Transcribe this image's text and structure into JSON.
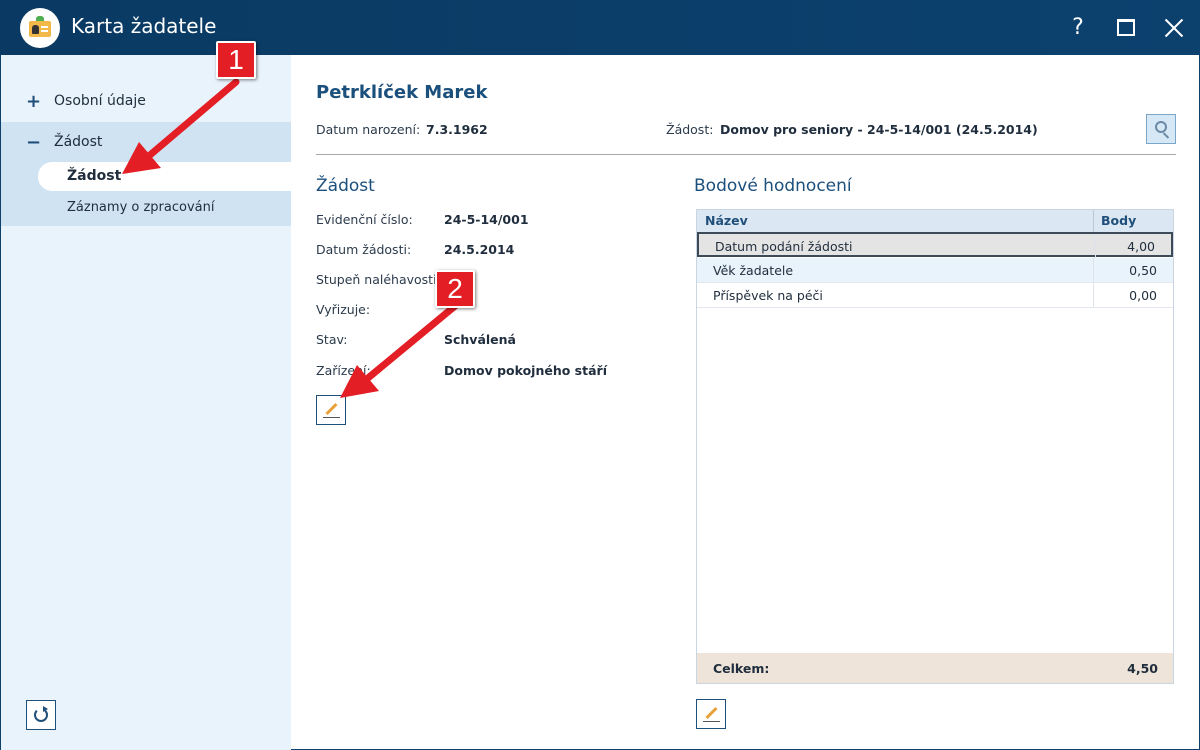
{
  "window": {
    "title": "Karta žadatele",
    "help_label": "?"
  },
  "sidebar": {
    "items": [
      {
        "sign": "+",
        "label": "Osobní údaje"
      },
      {
        "sign": "−",
        "label": "Žádost"
      }
    ],
    "subitems": [
      {
        "label": "Žádost",
        "active": true
      },
      {
        "label": "Záznamy o zpracování"
      }
    ]
  },
  "header": {
    "name": "Petrklíček Marek",
    "birth_label": "Datum narození:",
    "birth_value": "7.3.1962",
    "request_label": "Žádost:",
    "request_value": "Domov pro seniory - 24-5-14/001 (24.5.2014)"
  },
  "request": {
    "title": "Žádost",
    "fields": [
      {
        "label": "Evidenční číslo:",
        "value": "24-5-14/001"
      },
      {
        "label": "Datum žádosti:",
        "value": "24.5.2014"
      },
      {
        "label": "Stupeň naléhavosti:",
        "value": ""
      },
      {
        "label": "Vyřizuje:",
        "value": ""
      },
      {
        "label": "Stav:",
        "value": "Schválená"
      },
      {
        "label": "Zařízení:",
        "value": "Domov pokojného stáří"
      }
    ]
  },
  "scoring": {
    "title": "Bodové hodnocení",
    "columns": [
      "Název",
      "Body"
    ],
    "rows": [
      {
        "name": "Datum podání žádosti",
        "value": "4,00",
        "selected": true
      },
      {
        "name": "Věk žadatele",
        "value": "0,50"
      },
      {
        "name": "Příspěvek na péči",
        "value": "0,00"
      }
    ],
    "total_label": "Celkem:",
    "total_value": "4,50"
  },
  "callouts": [
    "1",
    "2"
  ],
  "colors": {
    "titlebar": "#0c416e",
    "sidebar": "#e9f3fb",
    "heading": "#1b4f7c",
    "callout": "#e31e24"
  }
}
